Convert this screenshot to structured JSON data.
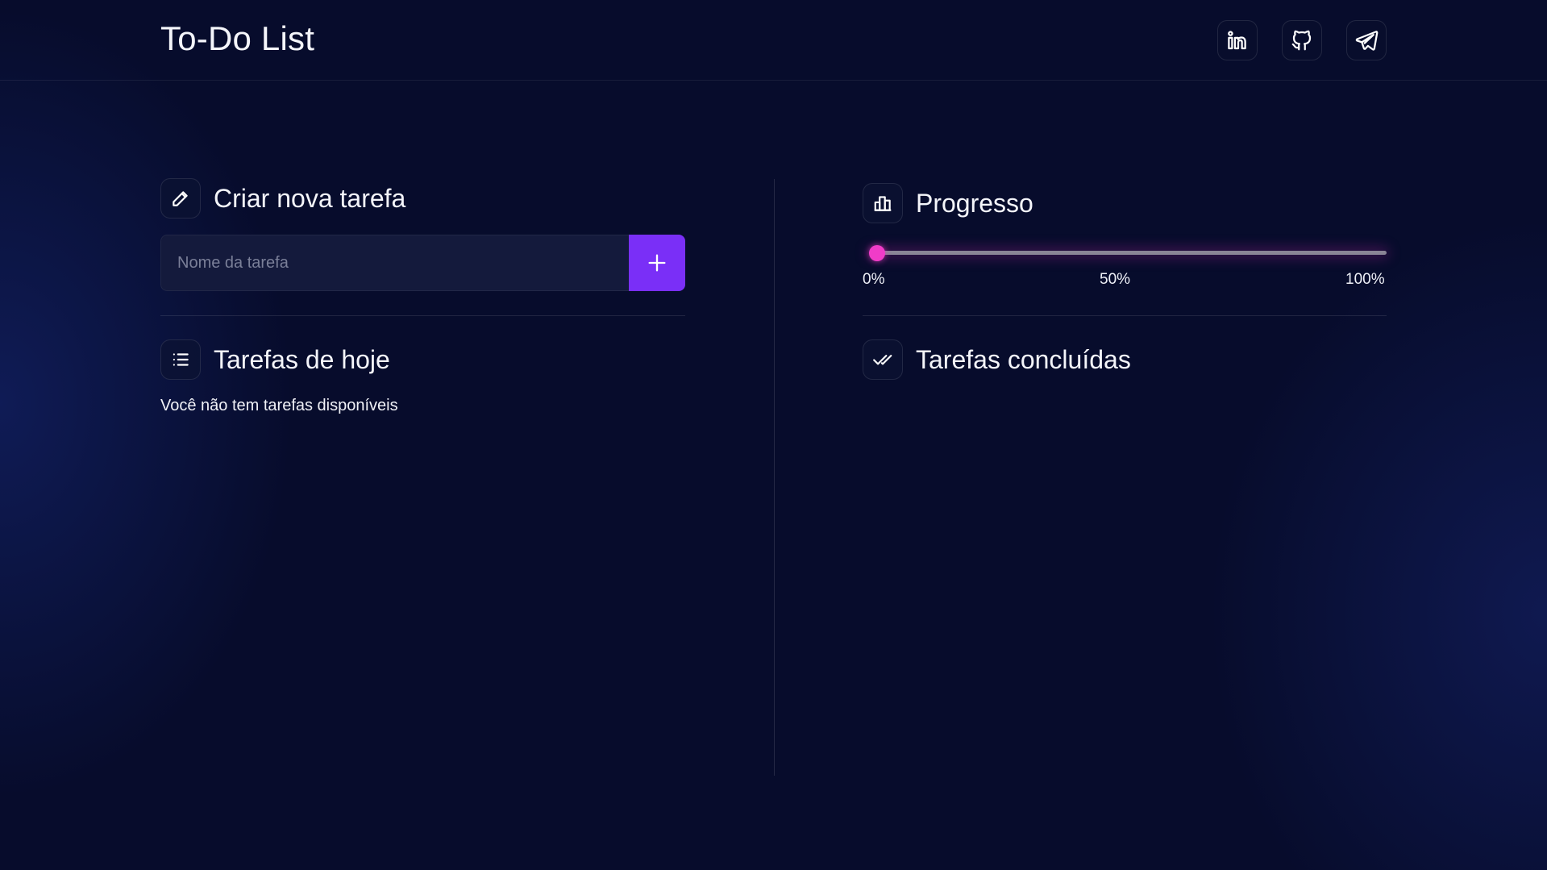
{
  "header": {
    "title": "To-Do List",
    "social_links": [
      {
        "name": "linkedin-icon"
      },
      {
        "name": "github-icon"
      },
      {
        "name": "telegram-icon"
      }
    ]
  },
  "create_task": {
    "title": "Criar nova tarefa",
    "icon": "pencil-icon",
    "input_value": "",
    "input_placeholder": "Nome da tarefa",
    "add_icon": "plus-icon"
  },
  "today_tasks": {
    "title": "Tarefas de hoje",
    "icon": "list-icon",
    "empty_message": "Você não tem tarefas disponíveis",
    "items": []
  },
  "progress": {
    "title": "Progresso",
    "icon": "bar-chart-icon",
    "value": 0,
    "ticks": [
      "0%",
      "50%",
      "100%"
    ]
  },
  "completed_tasks": {
    "title": "Tarefas concluídas",
    "icon": "double-check-icon",
    "items": []
  },
  "colors": {
    "background": "#070c2c",
    "accent_button": "#7a2ff7",
    "progress_accent": "#f03cc8"
  }
}
